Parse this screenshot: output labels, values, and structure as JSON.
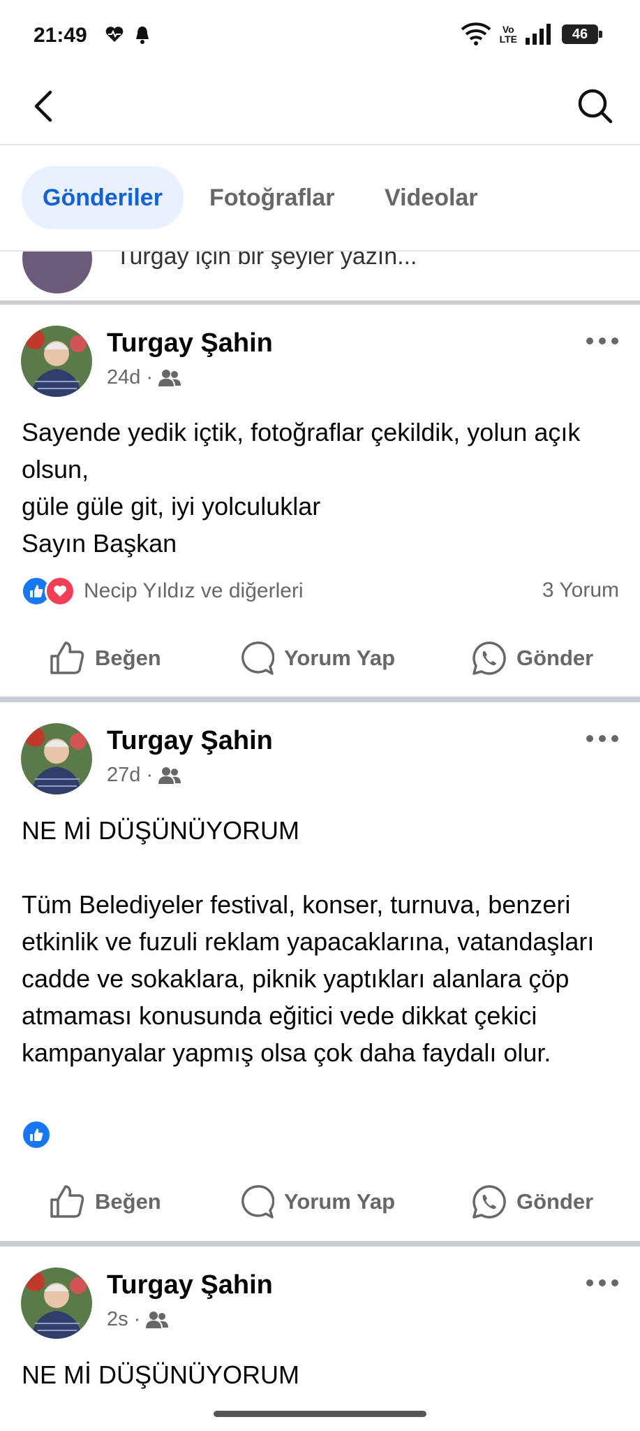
{
  "status": {
    "time": "21:49",
    "volte_top": "Vo",
    "volte_bottom": "LTE",
    "battery": "46"
  },
  "tabs": [
    {
      "label": "Gönderiler",
      "active": true
    },
    {
      "label": "Fotoğraflar",
      "active": false
    },
    {
      "label": "Videolar",
      "active": false
    }
  ],
  "peek": {
    "text": "Turgay için bir şeyler yazın..."
  },
  "posts": [
    {
      "author": "Turgay Şahin",
      "time": "24d",
      "text": "Sayende yedik içtik, fotoğraflar çekildik, yolun açık olsun,\ngüle güle git, iyi yolculuklar\nSayın Başkan",
      "reactions": "Necip Yıldız ve diğerleri",
      "comments": "3 Yorum"
    },
    {
      "author": "Turgay Şahin",
      "time": "27d",
      "text": "NE Mİ DÜŞÜNÜYORUM\n\nTüm Belediyeler festival, konser, turnuva, benzeri etkinlik ve fuzuli reklam yapacaklarına, vatandaşları cadde ve sokaklara, piknik yaptıkları alanlara çöp atmaması konusunda eğitici vede dikkat çekici kampanyalar yapmış olsa çok daha faydalı olur."
    },
    {
      "author": "Turgay Şahin",
      "time": "2s",
      "text": "NE Mİ DÜŞÜNÜYORUM"
    }
  ],
  "actions": {
    "like": "Beğen",
    "comment": "Yorum Yap",
    "send": "Gönder"
  },
  "colors": {
    "accent": "#1877f2",
    "active_tab_bg": "#e7f0fc",
    "active_tab_text": "#1461d4",
    "secondary_text": "#65676b",
    "love": "#f33e58"
  },
  "icons": [
    "back-arrow-icon",
    "search-icon",
    "heart-pulse-icon",
    "bell-icon",
    "wifi-icon",
    "signal-icon",
    "battery-icon",
    "friends-icon",
    "more-icon",
    "like-icon",
    "comment-icon",
    "whatsapp-icon",
    "love-icon"
  ]
}
